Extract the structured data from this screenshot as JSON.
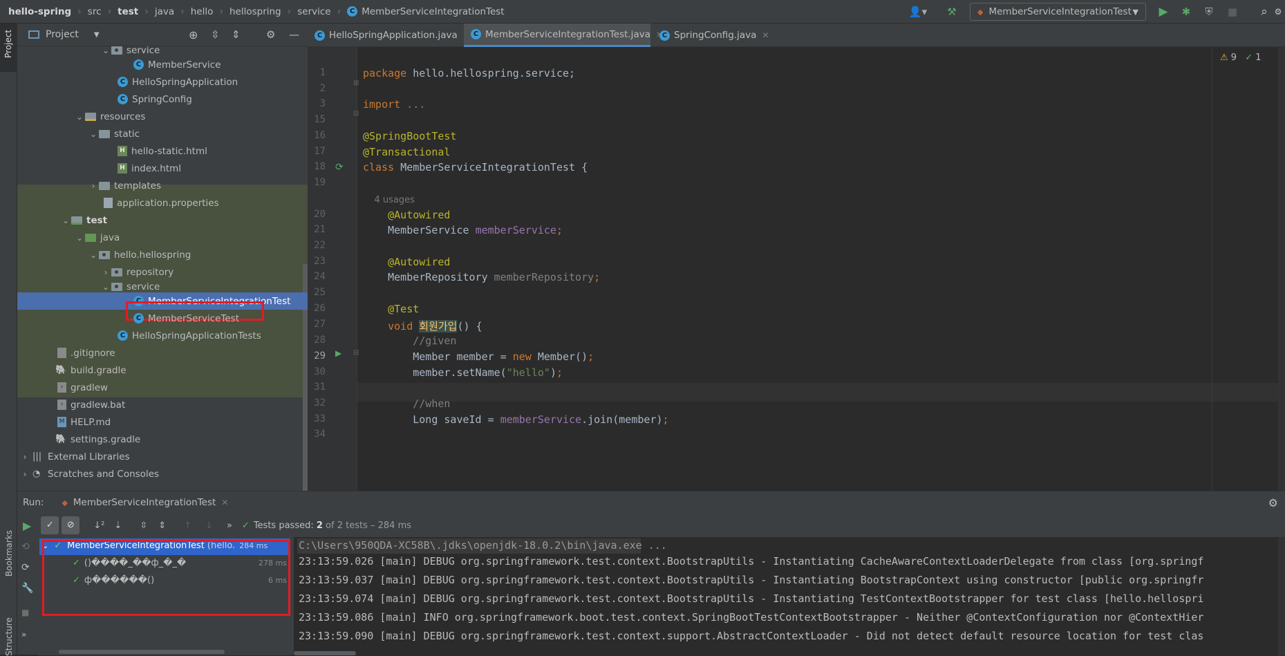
{
  "breadcrumb": [
    "hello-spring",
    "src",
    "test",
    "java",
    "hello",
    "hellospring",
    "service",
    "MemberServiceIntegrationTest"
  ],
  "run_config": "MemberServiceIntegrationTest",
  "project_panel": {
    "title": "Project"
  },
  "side_labels": {
    "project": "Project",
    "bookmarks": "Bookmarks",
    "structure": "Structure"
  },
  "tree": [
    {
      "label": "service",
      "kind": "pkg",
      "expanded": true
    },
    {
      "label": "MemberService",
      "kind": "class"
    },
    {
      "label": "HelloSpringApplication",
      "kind": "class"
    },
    {
      "label": "SpringConfig",
      "kind": "class"
    },
    {
      "label": "resources",
      "kind": "res",
      "expanded": true
    },
    {
      "label": "static",
      "kind": "folder",
      "expanded": true
    },
    {
      "label": "hello-static.html",
      "kind": "html"
    },
    {
      "label": "index.html",
      "kind": "html"
    },
    {
      "label": "templates",
      "kind": "folder",
      "expanded": false
    },
    {
      "label": "application.properties",
      "kind": "props"
    },
    {
      "label": "test",
      "kind": "tst",
      "expanded": true
    },
    {
      "label": "java",
      "kind": "src",
      "expanded": true
    },
    {
      "label": "hello.hellospring",
      "kind": "pkg",
      "expanded": true
    },
    {
      "label": "repository",
      "kind": "pkg",
      "expanded": false
    },
    {
      "label": "service",
      "kind": "pkg",
      "expanded": true
    },
    {
      "label": "MemberServiceIntegrationTest",
      "kind": "testclass",
      "selected": true
    },
    {
      "label": "MemberServiceTest",
      "kind": "testclass"
    },
    {
      "label": "HelloSpringApplicationTests",
      "kind": "testclass"
    },
    {
      "label": ".gitignore",
      "kind": "file"
    },
    {
      "label": "build.gradle",
      "kind": "gradle"
    },
    {
      "label": "gradlew",
      "kind": "file"
    },
    {
      "label": "gradlew.bat",
      "kind": "file"
    },
    {
      "label": "HELP.md",
      "kind": "md"
    },
    {
      "label": "settings.gradle",
      "kind": "gradle"
    },
    {
      "label": "External Libraries",
      "kind": "lib",
      "expanded": false
    },
    {
      "label": "Scratches and Consoles",
      "kind": "scratch",
      "expanded": false
    }
  ],
  "editor_tabs": [
    {
      "label": "HelloSpringApplication.java",
      "active": false
    },
    {
      "label": "MemberServiceIntegrationTest.java",
      "active": true
    },
    {
      "label": "SpringConfig.java",
      "active": false
    }
  ],
  "inspections": {
    "warnings": "9",
    "ok": "1"
  },
  "code": [
    {
      "ln": "1",
      "tokens": [
        [
          "kw",
          "package "
        ],
        [
          "",
          "hello.hellospring.service;"
        ]
      ]
    },
    {
      "ln": "2",
      "tokens": []
    },
    {
      "ln": "3",
      "tokens": [
        [
          "kw",
          "import "
        ],
        [
          "cmt",
          "..."
        ]
      ]
    },
    {
      "ln": "15",
      "tokens": []
    },
    {
      "ln": "16",
      "tokens": [
        [
          "ann",
          "@SpringBootTest"
        ]
      ]
    },
    {
      "ln": "17",
      "tokens": [
        [
          "ann",
          "@Transactional"
        ]
      ]
    },
    {
      "ln": "18",
      "tokens": [
        [
          "kw",
          "class "
        ],
        [
          "",
          "MemberServiceIntegrationTest {"
        ]
      ]
    },
    {
      "ln": "19",
      "tokens": []
    },
    {
      "ln": "",
      "tokens": [
        [
          "hint",
          "    4 usages"
        ]
      ]
    },
    {
      "ln": "20",
      "tokens": [
        [
          "ann",
          "    @Autowired"
        ]
      ]
    },
    {
      "ln": "21",
      "tokens": [
        [
          "",
          "    MemberService "
        ],
        [
          "fld",
          "memberService"
        ],
        [
          "kw",
          ";"
        ]
      ]
    },
    {
      "ln": "22",
      "tokens": []
    },
    {
      "ln": "23",
      "tokens": [
        [
          "ann",
          "    @Autowired"
        ]
      ]
    },
    {
      "ln": "24",
      "tokens": [
        [
          "",
          "    MemberRepository "
        ],
        [
          "cmt",
          "memberRepository"
        ],
        [
          "kw",
          ";"
        ]
      ]
    },
    {
      "ln": "25",
      "tokens": []
    },
    {
      "ln": "26",
      "tokens": [
        [
          "ann",
          "    @Test"
        ]
      ]
    },
    {
      "ln": "27",
      "tokens": [
        [
          "kw",
          "    void "
        ],
        [
          "hlname",
          "회원가입"
        ],
        [
          "",
          "() {"
        ]
      ]
    },
    {
      "ln": "28",
      "tokens": [
        [
          "cmt",
          "        //given"
        ]
      ]
    },
    {
      "ln": "29",
      "tokens": [
        [
          "",
          "        Member member = "
        ],
        [
          "kw",
          "new "
        ],
        [
          "",
          "Member()"
        ],
        [
          "kw",
          ";"
        ]
      ]
    },
    {
      "ln": "30",
      "tokens": [
        [
          "",
          "        member.setName("
        ],
        [
          "str",
          "\"hello\""
        ],
        [
          "",
          ")"
        ],
        [
          "kw",
          ";"
        ]
      ]
    },
    {
      "ln": "31",
      "tokens": []
    },
    {
      "ln": "32",
      "tokens": [
        [
          "cmt",
          "        //when"
        ]
      ]
    },
    {
      "ln": "33",
      "tokens": [
        [
          "",
          "        Long saveId = "
        ],
        [
          "fld",
          "memberService"
        ],
        [
          "",
          ".join(member)"
        ],
        [
          "kw",
          ";"
        ]
      ]
    },
    {
      "ln": "34",
      "tokens": []
    }
  ],
  "run": {
    "label": "Run:",
    "tab": "MemberServiceIntegrationTest",
    "status": "Tests passed: 2 of 2 tests – 284 ms",
    "status_prefix": "Tests passed: ",
    "status_count": "2",
    "status_rest": " of 2 tests – 284 ms",
    "tests": [
      {
        "label": "MemberServiceIntegrationTest",
        "detail": "(hello.",
        "time": "284 ms"
      },
      {
        "label": "()����_��ф_�_�",
        "time": "278 ms"
      },
      {
        "label": "ф������()",
        "time": "6 ms"
      }
    ],
    "console": [
      "C:\\Users\\950QDA-XC58B\\.jdks\\openjdk-18.0.2\\bin\\java.exe ...",
      "23:13:59.026 [main] DEBUG org.springframework.test.context.BootstrapUtils - Instantiating CacheAwareContextLoaderDelegate from class [org.springf",
      "23:13:59.037 [main] DEBUG org.springframework.test.context.BootstrapUtils - Instantiating BootstrapContext using constructor [public org.springfr",
      "23:13:59.074 [main] DEBUG org.springframework.test.context.BootstrapUtils - Instantiating TestContextBootstrapper for test class [hello.hellospri",
      "23:13:59.086 [main] INFO org.springframework.boot.test.context.SpringBootTestContextBootstrapper - Neither @ContextConfiguration nor @ContextHier",
      "23:13:59.090 [main] DEBUG org.springframework.test.context.support.AbstractContextLoader - Did not detect default resource location for test clas"
    ]
  }
}
